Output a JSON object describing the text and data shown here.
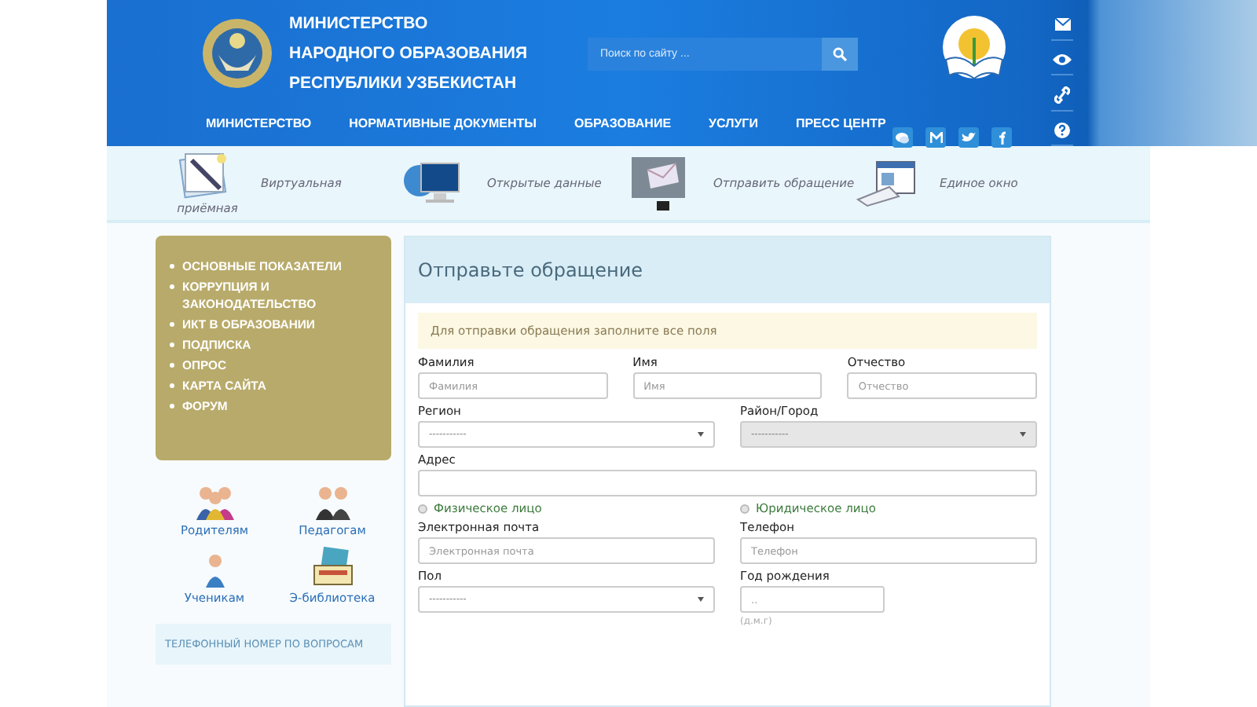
{
  "header": {
    "title_lines": [
      "МИНИСТЕРСТВО",
      "НАРОДНОГО ОБРАЗОВАНИЯ",
      "РЕСПУБЛИКИ УЗБЕКИСТАН"
    ],
    "search": {
      "placeholder": "Поиск по сайту ..."
    }
  },
  "nav": [
    "МИНИСТЕРСТВО",
    "НОРМАТИВНЫЕ ДОКУМЕНТЫ",
    "ОБРАЗОВАНИЕ",
    "УСЛУГИ",
    "ПРЕСС ЦЕНТР"
  ],
  "side_tools": [
    {
      "kind": "mail"
    },
    {
      "kind": "eye"
    },
    {
      "kind": "link"
    },
    {
      "kind": "help"
    }
  ],
  "social": [
    {
      "kind": "chat"
    },
    {
      "kind": "m"
    },
    {
      "kind": "bird"
    },
    {
      "kind": "f"
    }
  ],
  "quick_links": [
    {
      "kind": "notepad",
      "label": "Виртуальная",
      "sublabel": "приёмная"
    },
    {
      "kind": "monitor",
      "label": "Открытые данные"
    },
    {
      "kind": "envelope",
      "label": "Отправить обращение"
    },
    {
      "kind": "window",
      "label": "Единое окно"
    }
  ],
  "sidebar": {
    "menu": [
      "ОСНОВНЫЕ ПОКАЗАТЕЛИ",
      "КОРРУПЦИЯ И ЗАКОНОДАТЕЛЬСТВО",
      "ИКТ В ОБРАЗОВАНИИ",
      "ПОДПИСКА",
      "ОПРОС",
      "КАРТА САЙТА",
      "ФОРУМ"
    ],
    "categories": [
      {
        "kind": "family",
        "label": "Родителям"
      },
      {
        "kind": "teachers",
        "label": "Педагогам"
      },
      {
        "kind": "student",
        "label": "Ученикам"
      },
      {
        "kind": "library",
        "label": "Э-библиотека"
      }
    ],
    "phone_box": "ТЕЛЕФОННЫЙ НОМЕР ПО ВОПРОСАМ"
  },
  "form": {
    "title": "Отправьте обращение",
    "notice": "Для отправки обращения заполните все поля",
    "rows": [
      [
        {
          "kind": "text",
          "label": "Фамилия",
          "placeholder": "Фамилия"
        },
        {
          "kind": "text",
          "label": "Имя",
          "placeholder": "Имя"
        },
        {
          "kind": "text",
          "label": "Отчество",
          "placeholder": "Отчество"
        }
      ],
      [
        {
          "kind": "select",
          "label": "Регион",
          "value": "-----------",
          "disabled": false
        },
        {
          "kind": "select",
          "label": "Район/Город",
          "value": "-----------",
          "disabled": true
        }
      ],
      [
        {
          "kind": "text",
          "label": "Адрес"
        }
      ],
      [
        {
          "kind": "radio",
          "label": "Физическое лицо",
          "selected": false
        },
        {
          "kind": "radio",
          "label": "Юридическое лицо",
          "selected": false
        }
      ],
      [
        {
          "kind": "text",
          "label": "Электронная почта",
          "placeholder": "Электронная почта"
        },
        {
          "kind": "text",
          "label": "Телефон",
          "placeholder": "Телефон"
        }
      ],
      [
        {
          "kind": "select",
          "label": "Пол",
          "value": "-----------",
          "disabled": false
        },
        {
          "kind": "date",
          "label": "Год рождения",
          "placeholder": "..",
          "hint": "(д.м.г)"
        }
      ]
    ]
  }
}
